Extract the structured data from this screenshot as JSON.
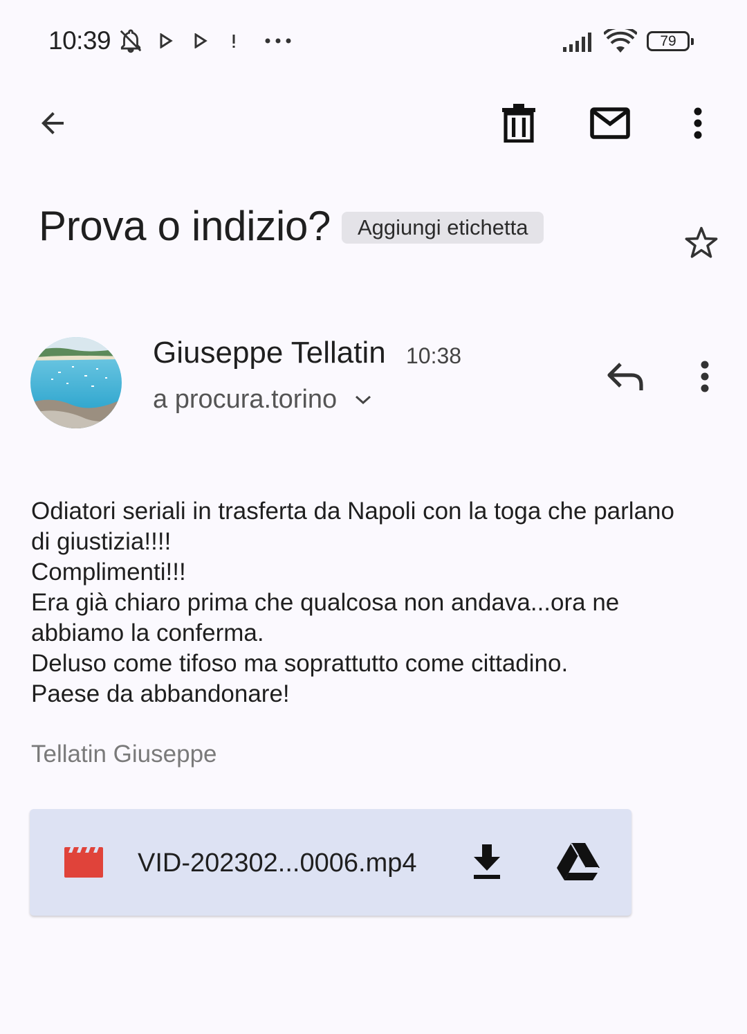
{
  "status_bar": {
    "time": "10:39",
    "battery": "79",
    "icons": [
      "bell-off-icon",
      "play-store-icon",
      "play-store-icon",
      "alert-icon",
      "more-dots-icon",
      "signal-icon",
      "wifi-icon",
      "battery-icon"
    ]
  },
  "toolbar": {
    "back": "arrow-back-icon",
    "delete": "trash-icon",
    "mark_unread": "mail-icon",
    "more": "more-vert-icon"
  },
  "email": {
    "subject": "Prova o indizio?",
    "label_chip": "Aggiungi etichetta",
    "star": "star-outline-icon",
    "sender_name": "Giuseppe Tellatin",
    "time": "10:38",
    "recipient": "a procura.torino",
    "body_lines": [
      "Odiatori seriali in trasferta da Napoli con la toga che parlano di giustizia!!!!",
      "Complimenti!!!",
      "Era già chiaro prima che qualcosa non andava...ora ne abbiamo la conferma.",
      "Deluso come tifoso ma soprattutto come cittadino.",
      "Paese da abbandonare!"
    ],
    "signature": "Tellatin Giuseppe"
  },
  "attachment": {
    "file_name": "VID-202302...0006.mp4",
    "file_icon": "video-file-icon",
    "download_icon": "download-icon",
    "drive_icon": "google-drive-icon"
  },
  "colors": {
    "background": "#fbf9fe",
    "chip_bg": "#e4e3e8",
    "attachment_bg": "#dde2f3",
    "video_icon": "#e0433a"
  }
}
